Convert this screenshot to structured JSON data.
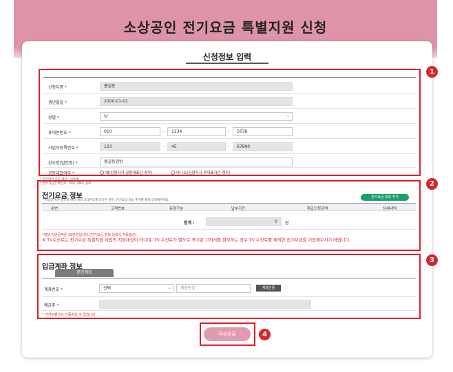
{
  "page": {
    "title": "소상공인 전기요금 특별지원 신청"
  },
  "card": {
    "title": "신청정보 입력"
  },
  "badges": [
    "1",
    "2",
    "3",
    "4"
  ],
  "applicant": {
    "name_label": "신청자명",
    "name_value": "홍길동",
    "birth_label": "생년월일",
    "birth_value": "2000-01-01",
    "gender_label": "성별",
    "gender_value": "남",
    "phone_label": "휴대폰번호",
    "phone_1": "010",
    "phone_2": "1234",
    "phone_3": "5678",
    "bizno_label": "사업자등록번호",
    "bizno_1": "123",
    "bizno_2": "45",
    "bizno_3": "67890",
    "company_label": "상호명(법인명)",
    "company_value": "홍길동경방",
    "rep_label": "공동대표여부",
    "rep_yes": "예(신청자가 공동대표인 경우)",
    "rep_no": "아니오(신청자가 주대표자인 경우)"
  },
  "upload_notes": [
    "* 첨부파일 용량 제한 : 10MB",
    "* 첨부가능한 확장자 : PDF, PNG, JPG"
  ],
  "electric": {
    "title": "전기요금 정보",
    "desc": "* 영업장 이전 등으로 여러 계좌 고객번호를 보유한 경우, 전기요금 정보 추가를 통해 입력해주세요.",
    "add_button": "전기요금 정보 추가",
    "columns": [
      "순번",
      "고객번호",
      "유형구분",
      "납부기간",
      "환급신청금액",
      "상세내역"
    ],
    "total_label": "합계 :",
    "total_value": "0",
    "total_unit": "원",
    "note_1": "*최대 지원금액은 20만원입니다.(전기요금 정보 입력시 자동합산)",
    "note_2": "※ TV수신료는 전기요금 특별지원 사업의 지원대상이 아니며, TV 수신료가 별도로 표기된 고지서를 첨부하는 경우 TV 수신료를 제외한 전기요금을 기입해주시기 바랍니다."
  },
  "account": {
    "title": "입금계좌 정보",
    "tab": "본인계좌",
    "acct_label": "계좌번호",
    "bank_select": "선택",
    "acct_placeholder": "계좌번호",
    "verify_button": "계좌인증",
    "holder_label": "예금주",
    "note": "* 카카오뱅크는 인증하실 수 없습니다."
  },
  "submit_button": "작성완료"
}
